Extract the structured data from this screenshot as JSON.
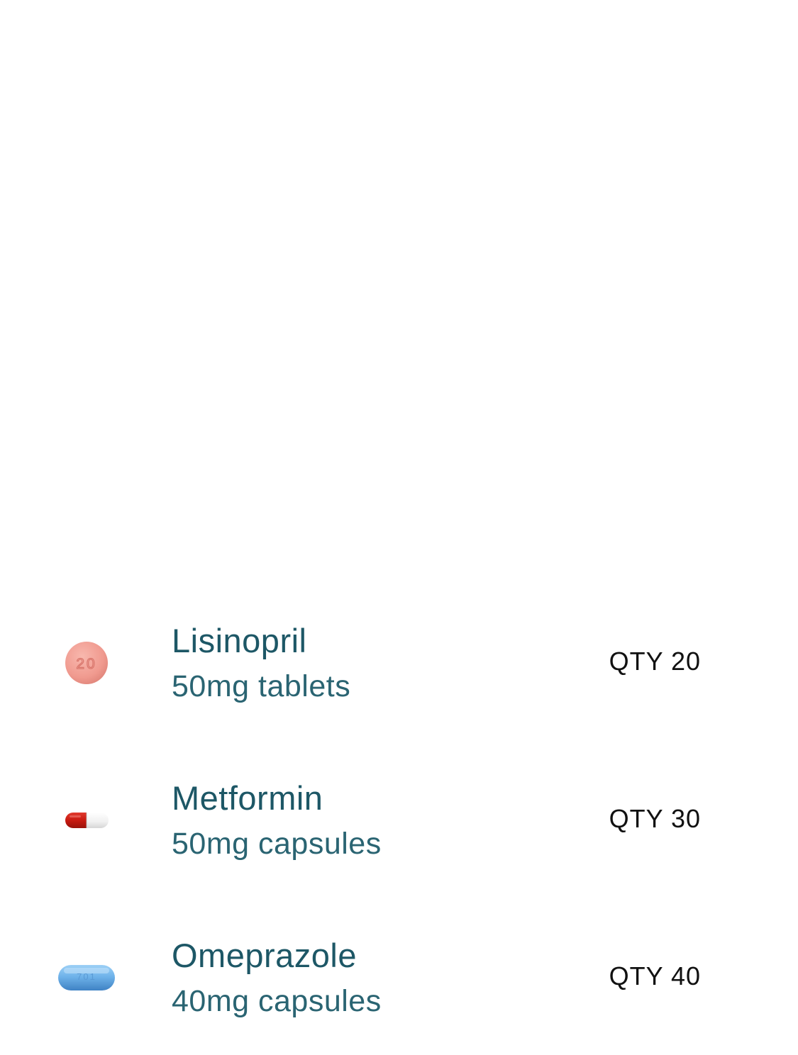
{
  "medications": [
    {
      "name": "Lisinopril",
      "dose": "50mg tablets",
      "qty": "QTY 20",
      "pill": {
        "shape": "round-tablet",
        "imprint": "20",
        "color": "#f2a096"
      }
    },
    {
      "name": "Metformin",
      "dose": "50mg capsules",
      "qty": "QTY 30",
      "pill": {
        "shape": "two-tone-capsule",
        "color_left": "#c81a10",
        "color_right": "#f2f2f2"
      }
    },
    {
      "name": "Omeprazole",
      "dose": "40mg capsules",
      "qty": "QTY 40",
      "pill": {
        "shape": "oblong-tablet",
        "imprint": "701",
        "color": "#6fb3ea"
      }
    }
  ]
}
